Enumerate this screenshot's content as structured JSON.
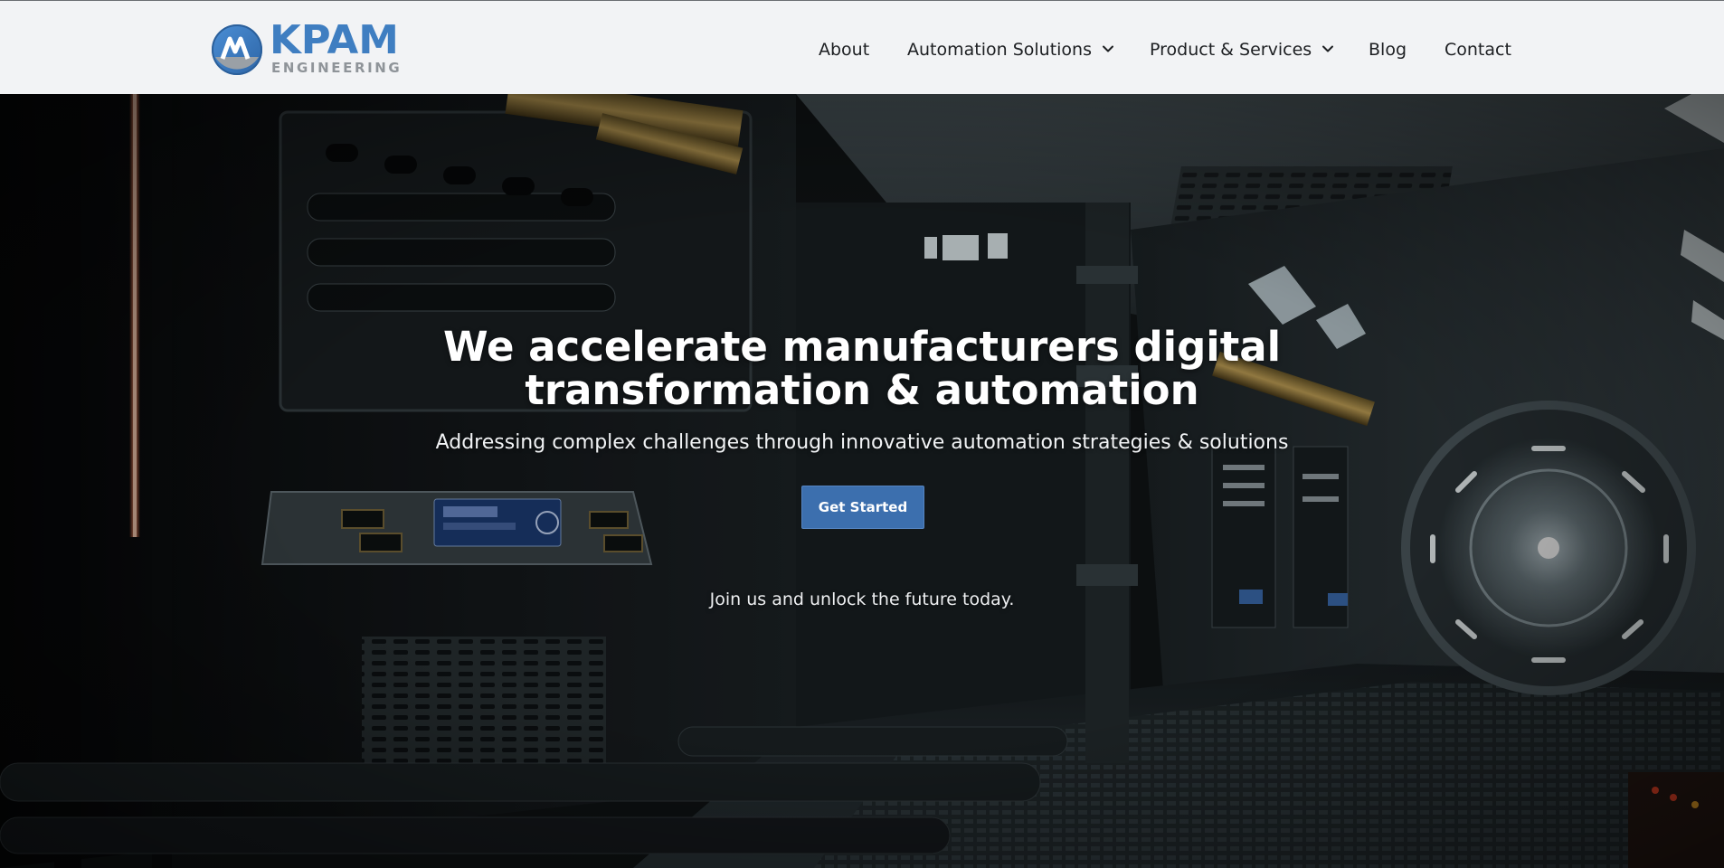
{
  "brand": {
    "name": "KPAM",
    "subtitle": "ENGINEERING",
    "primary_color": "#3f7ec1",
    "secondary_color": "#8f9499"
  },
  "nav": {
    "items": [
      {
        "label": "About",
        "has_dropdown": false
      },
      {
        "label": "Automation Solutions",
        "has_dropdown": true
      },
      {
        "label": "Product & Services",
        "has_dropdown": true
      },
      {
        "label": "Blog",
        "has_dropdown": false
      },
      {
        "label": "Contact",
        "has_dropdown": false
      }
    ]
  },
  "hero": {
    "headline_line1": "We accelerate manufacturers digital",
    "headline_line2": "transformation & automation",
    "subheadline": "Addressing complex challenges through innovative automation strategies & solutions",
    "cta_label": "Get Started",
    "cta_color": "#3c6fae",
    "tagline": "Join us and unlock the future today.",
    "background": "sci-fi-corridor-image"
  }
}
